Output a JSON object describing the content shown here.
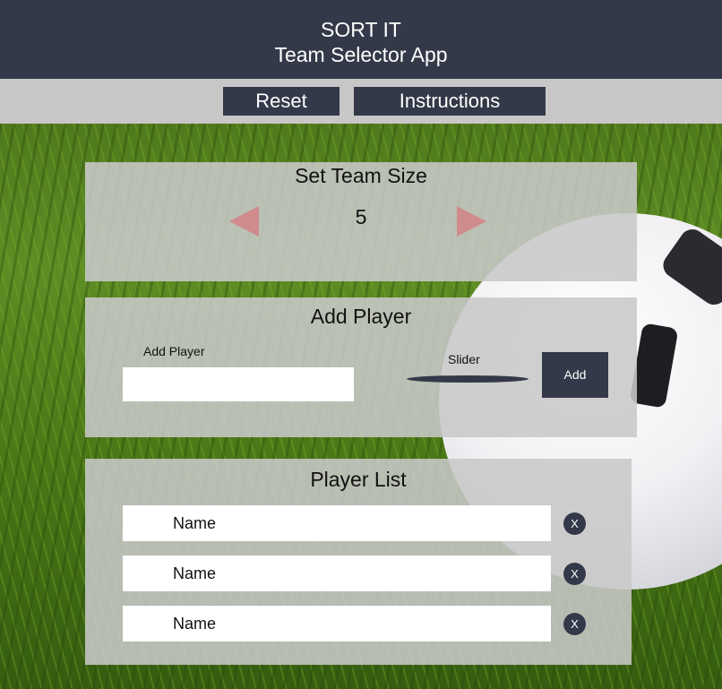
{
  "header": {
    "app_name": "SORT IT",
    "subtitle": "Team Selector App"
  },
  "nav": {
    "reset_label": "Reset",
    "instructions_label": "Instructions"
  },
  "team_size_panel": {
    "title": "Set Team Size",
    "value": "5",
    "decrement_icon": "triangle-left",
    "increment_icon": "triangle-right",
    "arrow_color": "#d08b8c"
  },
  "add_player_panel": {
    "title": "Add Player",
    "input_label": "Add Player",
    "input_value": "",
    "slider_label": "Slider",
    "add_label": "Add"
  },
  "player_list_panel": {
    "title": "Player List",
    "players": [
      {
        "name": "Name",
        "remove_label": "X"
      },
      {
        "name": "Name",
        "remove_label": "X"
      },
      {
        "name": "Name",
        "remove_label": "X"
      }
    ]
  },
  "colors": {
    "header_bg": "#333948",
    "nav_bg": "#c7c7c7",
    "panel_bg": "#c8c8c8",
    "accent": "#333948"
  }
}
